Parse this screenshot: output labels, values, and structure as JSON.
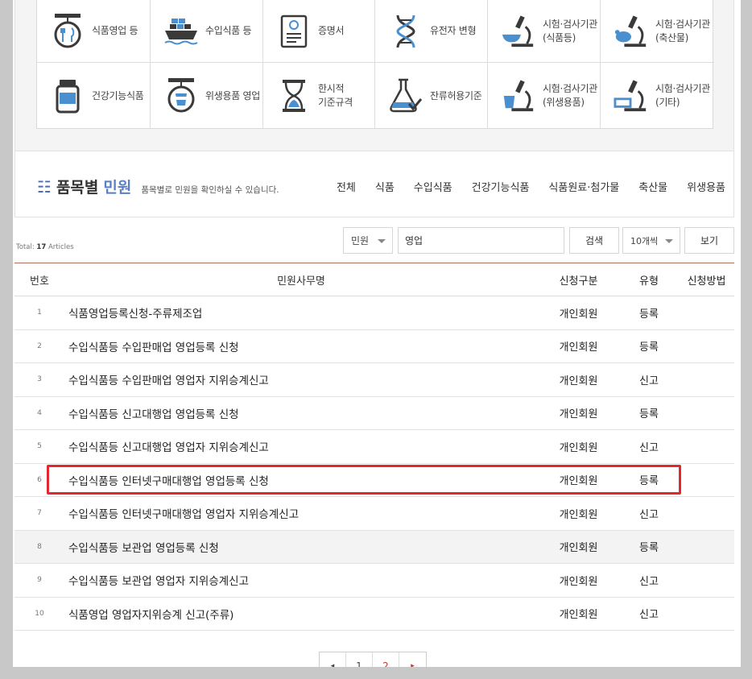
{
  "categories": [
    {
      "label": "식품영업 등",
      "icon": "restaurant-sign-icon"
    },
    {
      "label": "수입식품 등",
      "icon": "cargo-ship-icon"
    },
    {
      "label": "증명서",
      "icon": "certificate-icon"
    },
    {
      "label": "유전자 변형",
      "icon": "dna-icon"
    },
    {
      "label": "시험·검사기관\n(식품등)",
      "icon": "microscope-bowl-icon"
    },
    {
      "label": "시험·검사기관\n(축산물)",
      "icon": "microscope-chicken-icon"
    },
    {
      "label": "건강기능식품",
      "icon": "supplement-bottle-icon"
    },
    {
      "label": "위생용품 영업",
      "icon": "hygiene-cup-sign-icon"
    },
    {
      "label": "한시적\n기준규격",
      "icon": "hourglass-icon"
    },
    {
      "label": "잔류허용기준",
      "icon": "flask-check-icon"
    },
    {
      "label": "시험·검사기관\n(위생용품)",
      "icon": "microscope-cup-icon"
    },
    {
      "label": "시험·검사기관\n(기타)",
      "icon": "microscope-box-icon"
    }
  ],
  "section": {
    "title_part1": "품목별",
    "title_part2": "민원",
    "description": "품목별로 민원을 확인하실 수 있습니다.",
    "tabs": [
      "전체",
      "식품",
      "수입식품",
      "건강기능식품",
      "식품원료·첨가물",
      "축산물",
      "위생용품"
    ]
  },
  "search": {
    "total_label": "Total: ",
    "total_count": "17",
    "total_suffix": " Articles",
    "field_select": "민원",
    "keyword": "영업",
    "search_button": "검색",
    "page_size_select": "10개씩",
    "view_button": "보기"
  },
  "table": {
    "headers": {
      "no": "번호",
      "name": "민원사무명",
      "class": "신청구분",
      "type": "유형",
      "method": "신청방법"
    },
    "rows": [
      {
        "no": "1",
        "name": "식품영업등록신청-주류제조업",
        "class": "개인회원",
        "type": "등록",
        "method": ""
      },
      {
        "no": "2",
        "name": "수입식품등 수입판매업 영업등록 신청",
        "class": "개인회원",
        "type": "등록",
        "method": ""
      },
      {
        "no": "3",
        "name": "수입식품등 수입판매업 영업자 지위승계신고",
        "class": "개인회원",
        "type": "신고",
        "method": ""
      },
      {
        "no": "4",
        "name": "수입식품등 신고대행업 영업등록 신청",
        "class": "개인회원",
        "type": "등록",
        "method": ""
      },
      {
        "no": "5",
        "name": "수입식품등 신고대행업 영업자 지위승계신고",
        "class": "개인회원",
        "type": "신고",
        "method": ""
      },
      {
        "no": "6",
        "name": "수입식품등 인터넷구매대행업 영업등록 신청",
        "class": "개인회원",
        "type": "등록",
        "method": ""
      },
      {
        "no": "7",
        "name": "수입식품등 인터넷구매대행업 영업자 지위승계신고",
        "class": "개인회원",
        "type": "신고",
        "method": ""
      },
      {
        "no": "8",
        "name": "수입식품등 보관업 영업등록 신청",
        "class": "개인회원",
        "type": "등록",
        "method": ""
      },
      {
        "no": "9",
        "name": "수입식품등 보관업 영업자 지위승계신고",
        "class": "개인회원",
        "type": "신고",
        "method": ""
      },
      {
        "no": "10",
        "name": "식품영업 영업자지위승계 신고(주류)",
        "class": "개인회원",
        "type": "신고",
        "method": ""
      }
    ]
  },
  "pagination": {
    "prev": "◂",
    "pages": [
      "1",
      "2"
    ],
    "current": "2",
    "next": "▸"
  },
  "colors": {
    "accent": "#5a7fc7",
    "highlight": "#e0282e",
    "icon_dark": "#3a3a3a",
    "icon_blue": "#4a8fd0"
  }
}
